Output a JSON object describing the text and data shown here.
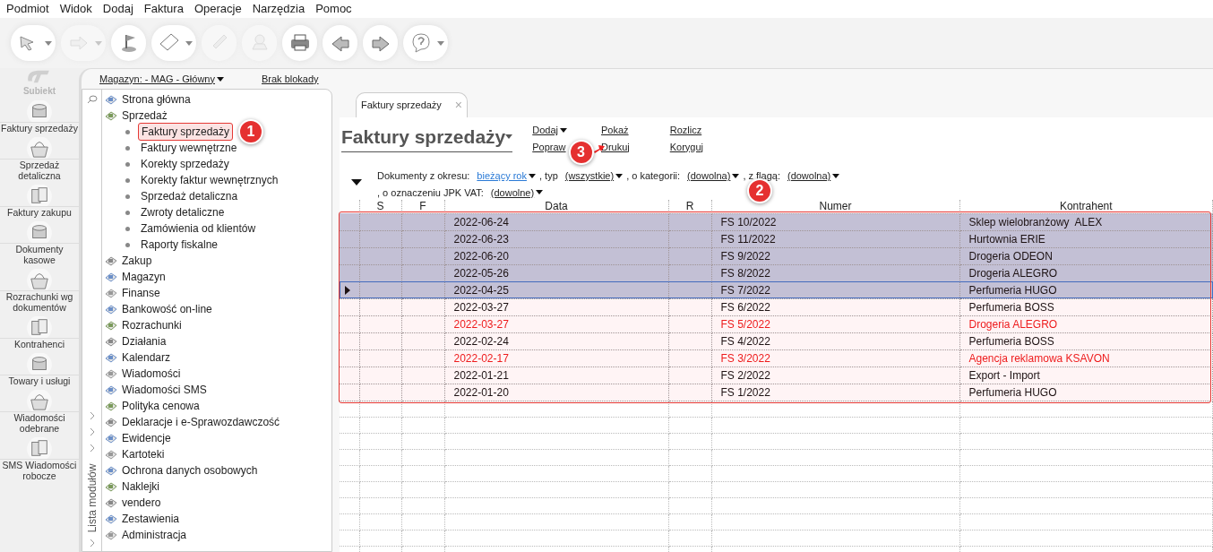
{
  "menu": [
    "Podmiot",
    "Widok",
    "Dodaj",
    "Faktura",
    "Operacje",
    "Narzędzia",
    "Pomoc"
  ],
  "toolbar": [
    {
      "dropdown": true,
      "disabled": false
    },
    {
      "dropdown": true,
      "disabled": true
    },
    {
      "dropdown": false,
      "disabled": false
    },
    {
      "dropdown": true,
      "disabled": false
    },
    {
      "dropdown": false,
      "disabled": true
    },
    {
      "dropdown": false,
      "disabled": true
    },
    {
      "dropdown": false,
      "disabled": false
    },
    {
      "dropdown": false,
      "disabled": false
    },
    {
      "dropdown": false,
      "disabled": false
    },
    {
      "dropdown": true,
      "disabled": false
    }
  ],
  "logo": {
    "text": "Subiekt"
  },
  "header_links": [
    "Magazyn: - MAG - Główny",
    "Brak blokady"
  ],
  "nav": [
    "Faktury sprzedaży",
    "Sprzedaż detaliczna",
    "Faktury zakupu",
    "Dokumenty kasowe",
    "Rozrachunki wg dokumentów",
    "Kontrahenci",
    "Towary i usługi",
    "Wiadomości odebrane",
    "SMS Wiadomości robocze"
  ],
  "modules": {
    "title": "Lista modułów",
    "items": [
      {
        "label": "Strona główna"
      },
      {
        "label": "Sprzedaż",
        "children": [
          {
            "label": "Faktury sprzedaży",
            "selected": true
          },
          {
            "label": "Faktury wewnętrzne",
            "selected": false
          },
          {
            "label": "Korekty sprzedaży",
            "selected": false
          },
          {
            "label": "Korekty faktur wewnętrznych",
            "selected": false
          },
          {
            "label": "Sprzedaż detaliczna",
            "selected": false
          },
          {
            "label": "Zwroty detaliczne",
            "selected": false
          },
          {
            "label": "Zamówienia od klientów",
            "selected": false
          },
          {
            "label": "Raporty fiskalne",
            "selected": false
          }
        ]
      },
      {
        "label": "Zakup"
      },
      {
        "label": "Magazyn"
      },
      {
        "label": "Finanse"
      },
      {
        "label": "Bankowość on-line"
      },
      {
        "label": "Rozrachunki"
      },
      {
        "label": "Działania"
      },
      {
        "label": "Kalendarz"
      },
      {
        "label": "Wiadomości"
      },
      {
        "label": "Wiadomości SMS"
      },
      {
        "label": "Polityka cenowa"
      },
      {
        "label": "Deklaracje i e-Sprawozdawczość"
      },
      {
        "label": "Ewidencje"
      },
      {
        "label": "Kartoteki"
      },
      {
        "label": "Ochrona danych osobowych"
      },
      {
        "label": "Naklejki"
      },
      {
        "label": "vendero"
      },
      {
        "label": "Zestawienia"
      },
      {
        "label": "Administracja"
      }
    ]
  },
  "tab": {
    "label": "Faktury sprzedaży",
    "close": "×"
  },
  "title": "Faktury sprzedaży",
  "actions": [
    {
      "label": "Dodaj",
      "dropdown": true
    },
    {
      "label": "Popraw",
      "dropdown": false
    },
    {
      "label": "Pokaż",
      "dropdown": false
    },
    {
      "label": "Drukuj",
      "dropdown": false
    },
    {
      "label": "Rozlicz",
      "dropdown": false
    },
    {
      "label": "Koryguj",
      "dropdown": false
    }
  ],
  "filters": [
    {
      "text": "Dokumenty z okresu:",
      "value": "bieżący rok"
    },
    {
      "text": ", typ",
      "value": "(wszystkie)"
    },
    {
      "text": ", o kategorii:",
      "value": "(dowolna)"
    },
    {
      "text": ", z flagą:",
      "value": "(dowolna)"
    },
    {
      "text": ", o oznaczeniu JPK VAT:",
      "value": "(dowolne)"
    }
  ],
  "table": {
    "columns": [
      "S",
      "F",
      "Data",
      "R",
      "Numer",
      "Kontrahent"
    ],
    "rows": [
      {
        "date": "2022-06-24",
        "number": "FS 10/2022",
        "contractor": "Sklep wielobranżowy  ALEX",
        "selected": true,
        "current": false,
        "alert": false
      },
      {
        "date": "2022-06-23",
        "number": "FS 11/2022",
        "contractor": "Hurtownia ERIE",
        "selected": true,
        "current": false,
        "alert": false
      },
      {
        "date": "2022-06-20",
        "number": "FS 9/2022",
        "contractor": "Drogeria ODEON",
        "selected": true,
        "current": false,
        "alert": false
      },
      {
        "date": "2022-05-26",
        "number": "FS 8/2022",
        "contractor": "Drogeria ALEGRO",
        "selected": true,
        "current": false,
        "alert": false
      },
      {
        "date": "2022-04-25",
        "number": "FS 7/2022",
        "contractor": "Perfumeria HUGO",
        "selected": true,
        "current": true,
        "alert": false
      },
      {
        "date": "2022-03-27",
        "number": "FS 6/2022",
        "contractor": "Perfumeria BOSS",
        "selected": false,
        "current": false,
        "alert": false
      },
      {
        "date": "2022-03-27",
        "number": "FS 5/2022",
        "contractor": "Drogeria ALEGRO",
        "selected": false,
        "current": false,
        "alert": true
      },
      {
        "date": "2022-02-24",
        "number": "FS 4/2022",
        "contractor": "Perfumeria BOSS",
        "selected": false,
        "current": false,
        "alert": false
      },
      {
        "date": "2022-02-17",
        "number": "FS 3/2022",
        "contractor": "Agencja reklamowa KSAVON",
        "selected": false,
        "current": false,
        "alert": true
      },
      {
        "date": "2022-01-21",
        "number": "FS 2/2022",
        "contractor": "Export - Import",
        "selected": false,
        "current": false,
        "alert": false
      },
      {
        "date": "2022-01-20",
        "number": "FS 1/2022",
        "contractor": "Perfumeria HUGO",
        "selected": false,
        "current": false,
        "alert": false
      }
    ]
  },
  "annotations": [
    "1",
    "2",
    "3"
  ]
}
